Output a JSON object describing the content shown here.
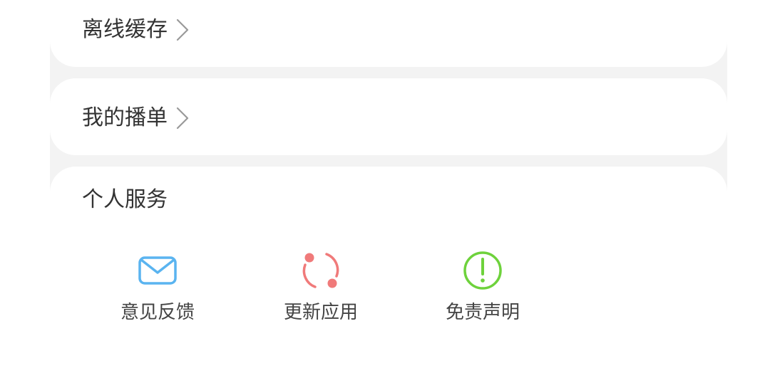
{
  "offline_cache": {
    "label": "离线缓存"
  },
  "my_playlist": {
    "label": "我的播单"
  },
  "personal_services": {
    "title": "个人服务",
    "items": [
      {
        "label": "意见反馈",
        "icon": "envelope-icon",
        "color": "#5ab4f0"
      },
      {
        "label": "更新应用",
        "icon": "refresh-icon",
        "color": "#f07a7a"
      },
      {
        "label": "免责声明",
        "icon": "exclamation-circle-icon",
        "color": "#6ed23c"
      }
    ]
  }
}
